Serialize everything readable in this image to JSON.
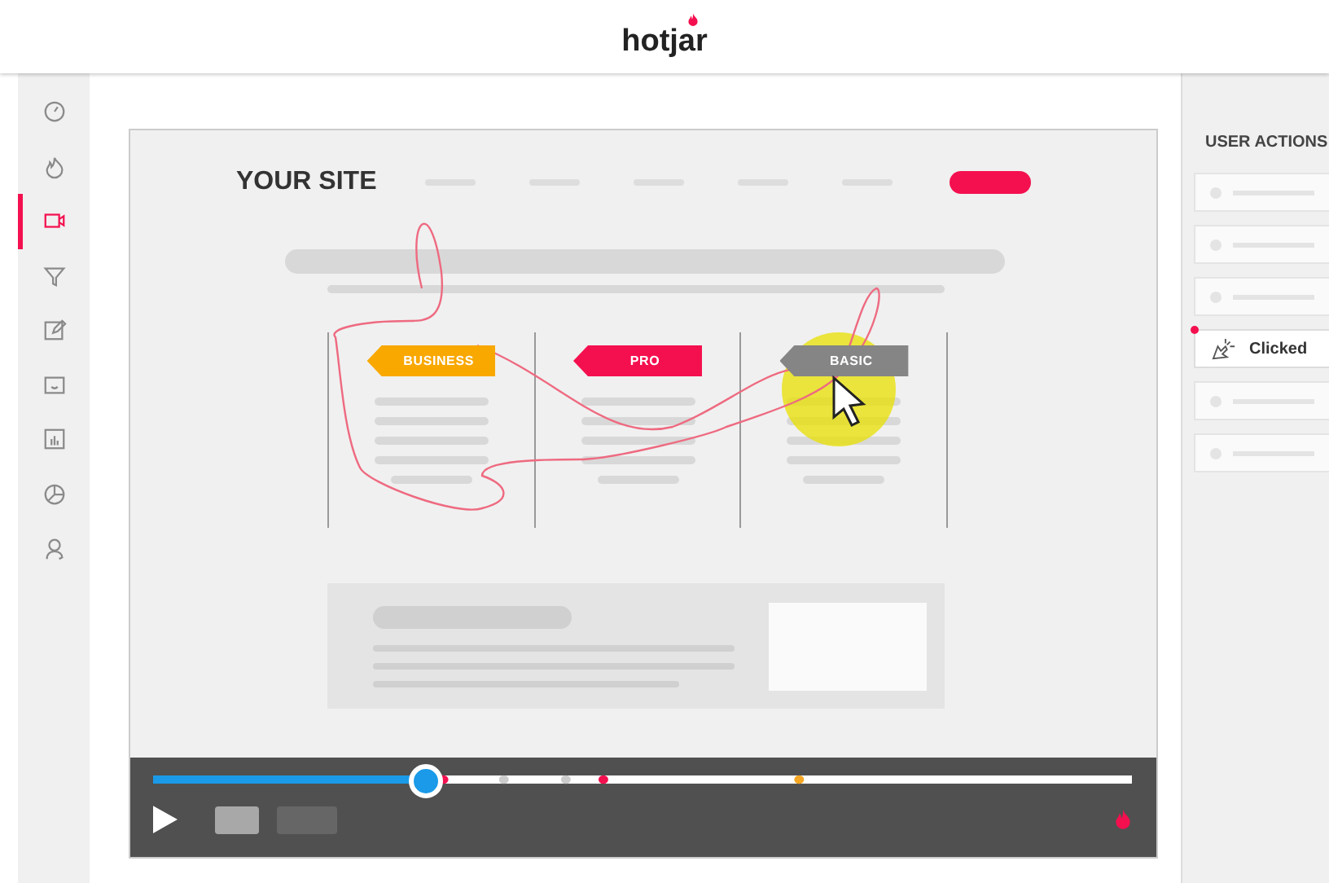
{
  "header": {
    "logo": "hotjar"
  },
  "sidebar": {
    "items": [
      {
        "selected": false
      },
      {
        "selected": false
      },
      {
        "selected": true
      },
      {
        "selected": false
      },
      {
        "selected": false
      },
      {
        "selected": false
      },
      {
        "selected": false
      },
      {
        "selected": false
      },
      {
        "selected": false
      }
    ]
  },
  "site": {
    "title": "YOUR SITE",
    "plans": [
      {
        "label": "BUSINESS",
        "color": "#f9a800"
      },
      {
        "label": "PRO",
        "color": "#f4104f"
      },
      {
        "label": "BASIC",
        "color": "#858585"
      }
    ]
  },
  "player": {
    "level": 0.28
  },
  "user_actions": {
    "title": "USER ACTIONS",
    "items": [
      {
        "kind": "placeholder"
      },
      {
        "kind": "placeholder"
      },
      {
        "kind": "placeholder"
      },
      {
        "kind": "event",
        "label": "Clicked"
      },
      {
        "kind": "placeholder"
      },
      {
        "kind": "placeholder"
      }
    ]
  }
}
